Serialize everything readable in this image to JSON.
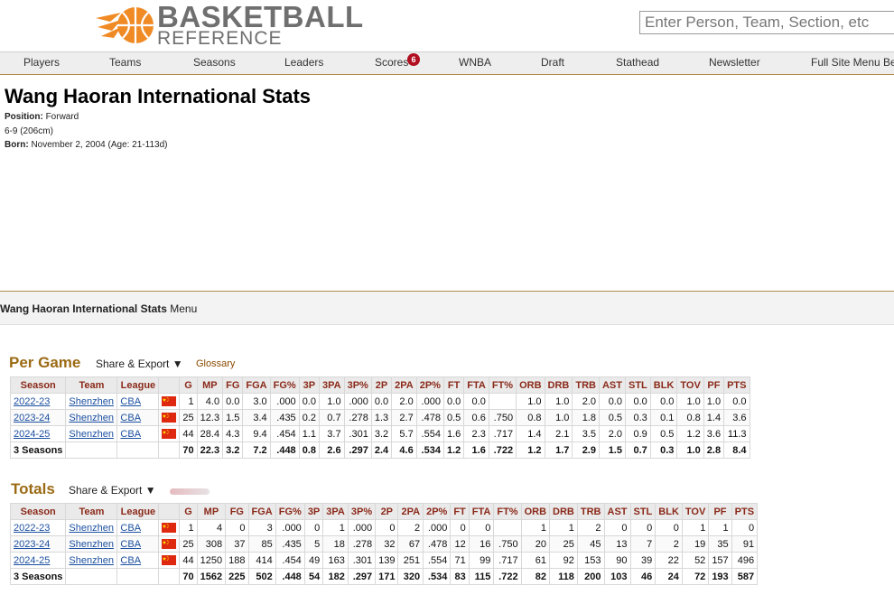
{
  "header": {
    "logo_line1": "BASKETBALL",
    "logo_line2": "REFERENCE",
    "search_placeholder": "Enter Person, Team, Section, etc"
  },
  "nav": {
    "items": [
      "Players",
      "Teams",
      "Seasons",
      "Leaders",
      "Scores",
      "WNBA",
      "Draft",
      "Stathead",
      "Newsletter",
      "Full Site Menu Be"
    ],
    "scores_badge": "6"
  },
  "player": {
    "name": "Wang Haoran International Stats",
    "position_label": "Position:",
    "position_value": "Forward",
    "height_weight": "6-9 (206cm)",
    "born_label": "Born:",
    "born_value": "November 2, 2004 (Age: 21-113d)"
  },
  "section_menu": {
    "title": "Wang Haoran International Stats",
    "suffix": "Menu"
  },
  "per_game": {
    "title": "Per Game",
    "share_label": "Share & Export ▼",
    "glossary_label": "Glossary",
    "columns": [
      "Season",
      "Team",
      "League",
      "",
      "G",
      "MP",
      "FG",
      "FGA",
      "FG%",
      "3P",
      "3PA",
      "3P%",
      "2P",
      "2PA",
      "2P%",
      "FT",
      "FTA",
      "FT%",
      "ORB",
      "DRB",
      "TRB",
      "AST",
      "STL",
      "BLK",
      "TOV",
      "PF",
      "PTS"
    ],
    "rows": [
      [
        "2022-23",
        "Shenzhen",
        "CBA",
        "",
        "1",
        "4.0",
        "0.0",
        "3.0",
        ".000",
        "0.0",
        "1.0",
        ".000",
        "0.0",
        "2.0",
        ".000",
        "0.0",
        "0.0",
        "",
        "1.0",
        "1.0",
        "2.0",
        "0.0",
        "0.0",
        "0.0",
        "1.0",
        "1.0",
        "0.0"
      ],
      [
        "2023-24",
        "Shenzhen",
        "CBA",
        "",
        "25",
        "12.3",
        "1.5",
        "3.4",
        ".435",
        "0.2",
        "0.7",
        ".278",
        "1.3",
        "2.7",
        ".478",
        "0.5",
        "0.6",
        ".750",
        "0.8",
        "1.0",
        "1.8",
        "0.5",
        "0.3",
        "0.1",
        "0.8",
        "1.4",
        "3.6"
      ],
      [
        "2024-25",
        "Shenzhen",
        "CBA",
        "",
        "44",
        "28.4",
        "4.3",
        "9.4",
        ".454",
        "1.1",
        "3.7",
        ".301",
        "3.2",
        "5.7",
        ".554",
        "1.6",
        "2.3",
        ".717",
        "1.4",
        "2.1",
        "3.5",
        "2.0",
        "0.9",
        "0.5",
        "1.2",
        "3.6",
        "11.3"
      ]
    ],
    "footer": [
      "3 Seasons",
      "",
      "",
      "",
      "70",
      "22.3",
      "3.2",
      "7.2",
      ".448",
      "0.8",
      "2.6",
      ".297",
      "2.4",
      "4.6",
      ".534",
      "1.2",
      "1.6",
      ".722",
      "1.2",
      "1.7",
      "2.9",
      "1.5",
      "0.7",
      "0.3",
      "1.0",
      "2.8",
      "8.4"
    ]
  },
  "totals": {
    "title": "Totals",
    "share_label": "Share & Export ▼",
    "columns": [
      "Season",
      "Team",
      "League",
      "",
      "G",
      "MP",
      "FG",
      "FGA",
      "FG%",
      "3P",
      "3PA",
      "3P%",
      "2P",
      "2PA",
      "2P%",
      "FT",
      "FTA",
      "FT%",
      "ORB",
      "DRB",
      "TRB",
      "AST",
      "STL",
      "BLK",
      "TOV",
      "PF",
      "PTS"
    ],
    "rows": [
      [
        "2022-23",
        "Shenzhen",
        "CBA",
        "",
        "1",
        "4",
        "0",
        "3",
        ".000",
        "0",
        "1",
        ".000",
        "0",
        "2",
        ".000",
        "0",
        "0",
        "",
        "1",
        "1",
        "2",
        "0",
        "0",
        "0",
        "1",
        "1",
        "0"
      ],
      [
        "2023-24",
        "Shenzhen",
        "CBA",
        "",
        "25",
        "308",
        "37",
        "85",
        ".435",
        "5",
        "18",
        ".278",
        "32",
        "67",
        ".478",
        "12",
        "16",
        ".750",
        "20",
        "25",
        "45",
        "13",
        "7",
        "2",
        "19",
        "35",
        "91"
      ],
      [
        "2024-25",
        "Shenzhen",
        "CBA",
        "",
        "44",
        "1250",
        "188",
        "414",
        ".454",
        "49",
        "163",
        ".301",
        "139",
        "251",
        ".554",
        "71",
        "99",
        ".717",
        "61",
        "92",
        "153",
        "90",
        "39",
        "22",
        "52",
        "157",
        "496"
      ]
    ],
    "footer": [
      "3 Seasons",
      "",
      "",
      "",
      "70",
      "1562",
      "225",
      "502",
      ".448",
      "54",
      "182",
      ".297",
      "171",
      "320",
      ".534",
      "83",
      "115",
      ".722",
      "82",
      "118",
      "200",
      "103",
      "46",
      "24",
      "72",
      "193",
      "587"
    ]
  },
  "colors": {
    "accent": "#9b6b14",
    "header_text": "#8b2a1a",
    "link": "#1a4fa0",
    "logo_orange": "#f08a24",
    "badge": "#b01020"
  },
  "icons": {
    "logo": "basketball-logo-icon",
    "flag": "china-flag-icon"
  }
}
